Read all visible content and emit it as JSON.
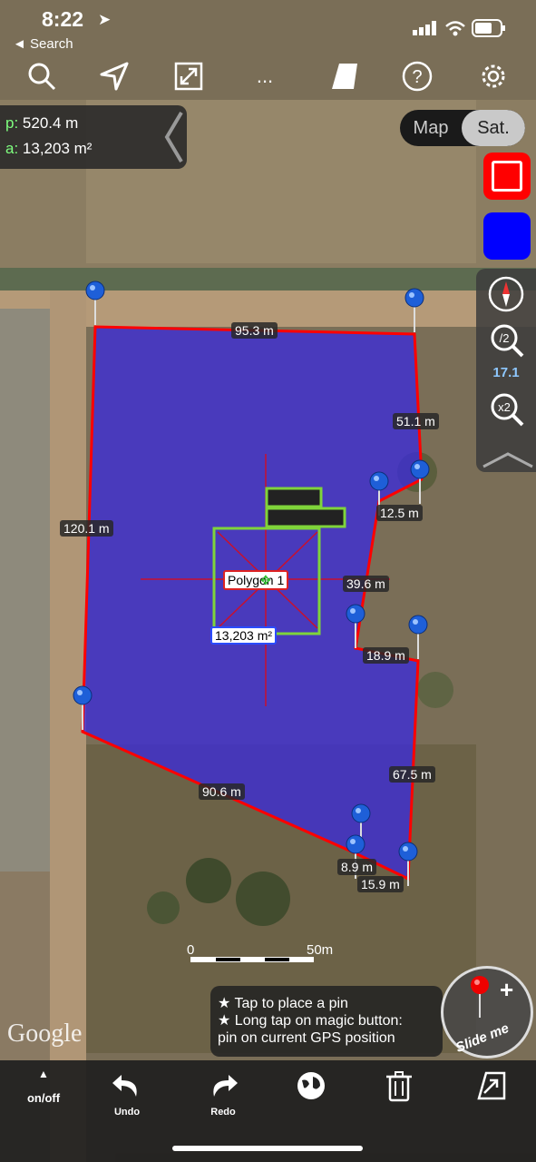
{
  "status": {
    "time": "8:22",
    "back_label": "◄ Search"
  },
  "toolbar": {
    "icons": [
      "search-icon",
      "location-arrow-icon",
      "fit-bounds-icon",
      "more-icon",
      "shape-icon",
      "help-icon",
      "settings-icon"
    ],
    "more_label": "..."
  },
  "measure": {
    "p_key": "p:",
    "p_value": "520.4 m",
    "a_key": "a:",
    "a_value": "13,203 m²"
  },
  "map_toggle": {
    "map": "Map",
    "sat": "Sat."
  },
  "colors": {
    "border": "#ff0000",
    "fill": "#3b2bd9",
    "accent": "#0000ff"
  },
  "zoom": {
    "level": "17.1"
  },
  "polygon": {
    "name": "Polygon 1",
    "area": "13,203 m²"
  },
  "distances": [
    "95.3 m",
    "51.1 m",
    "12.5 m",
    "39.6 m",
    "18.9 m",
    "67.5 m",
    "15.9 m",
    "8.9 m",
    "90.6 m",
    "120.1 m"
  ],
  "scale": {
    "start": "0",
    "end": "50m"
  },
  "hint": {
    "line1": "★ Tap to place a pin",
    "line2": "★ Long tap on magic button:",
    "line3": "pin on current GPS position"
  },
  "slide_me": "Slide me",
  "google": "Google",
  "bottom": {
    "onoff": "on/off",
    "undo": "Undo",
    "redo": "Redo"
  }
}
